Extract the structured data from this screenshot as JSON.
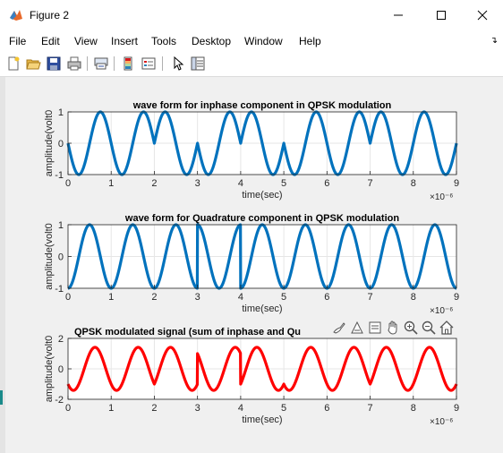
{
  "window": {
    "title": "Figure 2"
  },
  "menu": [
    "File",
    "Edit",
    "View",
    "Insert",
    "Tools",
    "Desktop",
    "Window",
    "Help"
  ],
  "toolbar": {
    "icons": [
      "new-figure-icon",
      "open-file-icon",
      "save-icon",
      "print-icon",
      "link-icon",
      "colorbar-icon",
      "legend-icon",
      "pointer-icon",
      "property-inspector-icon"
    ]
  },
  "axes_toolbar": [
    "brush-icon",
    "data-tips-icon",
    "export-icon",
    "pan-icon",
    "zoom-in-icon",
    "zoom-out-icon",
    "home-icon"
  ],
  "colors": {
    "blue": "#0072bd",
    "red": "#ff0000"
  },
  "chart_data": [
    {
      "type": "line",
      "title": "wave form for inphase component in QPSK modulation",
      "xlabel": "time(sec)",
      "ylabel": "amplitude(volt0",
      "xlim": [
        0,
        9
      ],
      "ylim": [
        -1,
        1
      ],
      "x_ticks": [
        "0",
        "1",
        "2",
        "3",
        "4",
        "5",
        "6",
        "7",
        "8",
        "9"
      ],
      "y_ticks": [
        "-1",
        "0",
        "1"
      ],
      "x_exponent": "×10⁻⁶",
      "grid": true,
      "series": [
        {
          "color": "#0072bd",
          "function": "sign_k * sin(2π f t)",
          "carrier_freq_MHz": 1,
          "symbol_period_us": 1,
          "sign_per_symbol": [
            -1,
            -1,
            1,
            -1,
            1,
            -1,
            -1,
            1,
            1
          ]
        }
      ]
    },
    {
      "type": "line",
      "title": "wave form for Quadrature component in QPSK modulation",
      "xlabel": "time(sec)",
      "ylabel": "amplitude(volt0",
      "xlim": [
        0,
        9
      ],
      "ylim": [
        -1,
        1
      ],
      "x_ticks": [
        "0",
        "1",
        "2",
        "3",
        "4",
        "5",
        "6",
        "7",
        "8",
        "9"
      ],
      "y_ticks": [
        "-1",
        "0",
        "1"
      ],
      "x_exponent": "×10⁻⁶",
      "grid": true,
      "series": [
        {
          "color": "#0072bd",
          "function": "sign_k * cos(2π f t)",
          "carrier_freq_MHz": 1,
          "symbol_period_us": 1,
          "sign_per_symbol": [
            -1,
            -1,
            -1,
            1,
            -1,
            -1,
            -1,
            -1,
            -1
          ]
        }
      ]
    },
    {
      "type": "line",
      "title": "QPSK modulated signal (sum of inphase and Qu",
      "xlabel": "time(sec)",
      "ylabel": "amplitude(volt0",
      "xlim": [
        0,
        9
      ],
      "ylim": [
        -2,
        2
      ],
      "x_ticks": [
        "0",
        "1",
        "2",
        "3",
        "4",
        "5",
        "6",
        "7",
        "8",
        "9"
      ],
      "y_ticks": [
        "-2",
        "0",
        "2"
      ],
      "x_exponent": "×10⁻⁶",
      "grid": true,
      "series": [
        {
          "color": "#ff0000",
          "function": "inphase + quadrature"
        }
      ]
    }
  ]
}
